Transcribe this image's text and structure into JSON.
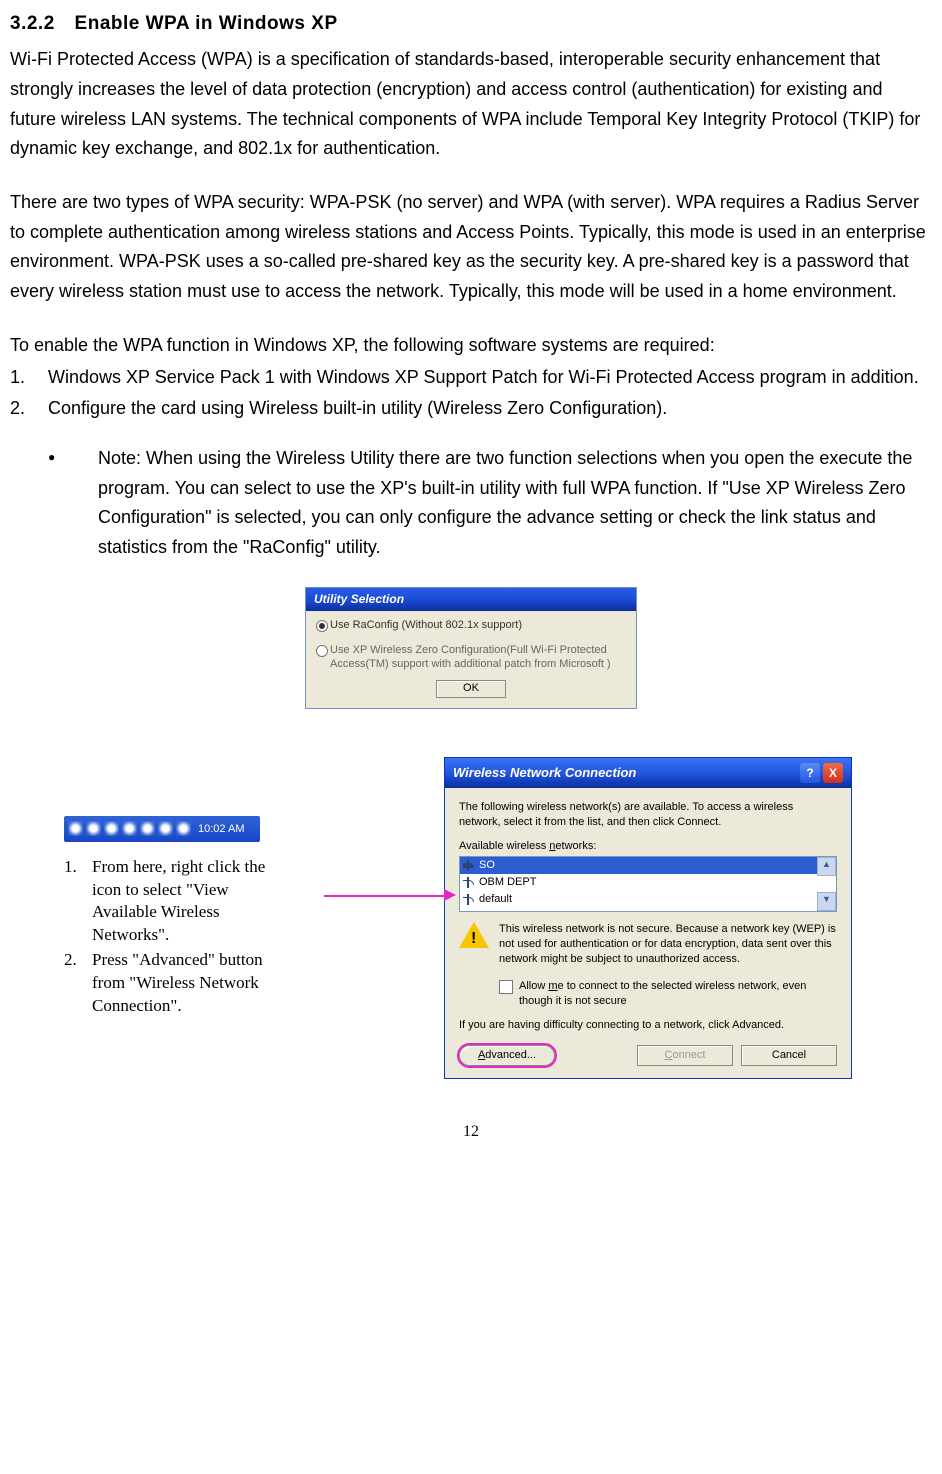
{
  "section": {
    "number": "3.2.2",
    "title": "Enable WPA in Windows XP"
  },
  "para1": "Wi-Fi Protected Access (WPA) is a specification of standards-based, interoperable security enhancement that strongly increases the level of data protection (encryption) and access control (authentication) for existing and future wireless LAN systems. The technical components of WPA include Temporal Key Integrity Protocol (TKIP) for dynamic key exchange, and 802.1x for authentication.",
  "para2": "There are two types of WPA security: WPA-PSK (no server) and WPA (with server). WPA requires a Radius Server to complete authentication among wireless stations and Access Points. Typically, this mode is used in an enterprise environment. WPA-PSK uses a so-called pre-shared key as the security key. A pre-shared key is a password that every wireless station must use to access the network. Typically, this mode will be used in a home environment.",
  "para3": "To enable the WPA function in Windows XP, the following software systems are required:",
  "req": [
    "Windows XP Service Pack 1 with Windows XP Support Patch for Wi-Fi Protected Access program in addition.",
    "Configure the card using Wireless built-in utility (Wireless Zero Configuration)."
  ],
  "note": "Note: When using the Wireless Utility there are two function selections when you open the execute the program. You can select to use the XP's built-in utility with full WPA function. If \"Use XP Wireless Zero Configuration\" is selected, you can only configure the advance setting or check the link status and statistics from the \"RaConfig\" utility.",
  "dlg1": {
    "title": "Utility Selection",
    "opt1": "Use RaConfig (Without 802.1x support)",
    "opt2": "Use XP Wireless Zero Configuration(Full Wi-Fi Protected Access(TM) support with additional patch from Microsoft )",
    "ok": "OK"
  },
  "taskbar": {
    "time": "10:02 AM"
  },
  "steps": [
    "From here, right click the icon to select \"View Available Wireless Networks\".",
    "Press \"Advanced\" button from \"Wireless Network Connection\"."
  ],
  "dlg2": {
    "title": "Wireless Network Connection",
    "intro": "The following wireless network(s) are available. To access a wireless network, select it from the list, and then click Connect.",
    "list_label_pre": "Available wireless ",
    "list_label_ul": "n",
    "list_label_post": "etworks:",
    "nets": [
      "SO",
      "OBM DEPT",
      "default"
    ],
    "warn": "This wireless network is not secure. Because a network key (WEP) is not used for authentication or for data encryption, data sent over this network might be subject to unauthorized access.",
    "cb_pre": "Allow ",
    "cb_ul": "m",
    "cb_post": "e to connect to the selected wireless network, even though it is not secure",
    "difficulty": "If you are having difficulty connecting to a network, click Advanced.",
    "adv_ul": "A",
    "adv_post": "dvanced...",
    "connect_ul": "C",
    "connect_post": "onnect",
    "cancel": "Cancel",
    "help": "?",
    "close": "X"
  },
  "page_num": "12"
}
